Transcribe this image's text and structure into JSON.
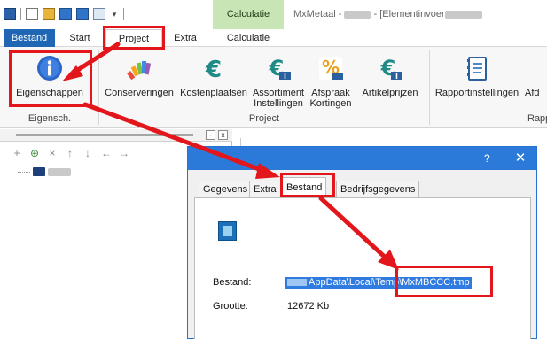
{
  "titlebar": {
    "context_tab": "Calculatie",
    "app_name": "MxMetaal - ",
    "separator": " - [Elementinvoer"
  },
  "tabs": {
    "file": "Bestand",
    "start": "Start",
    "project": "Project",
    "extra": "Extra",
    "calc": "Calculatie"
  },
  "ribbon": {
    "properties": "Eigenschappen",
    "conservations": "Conserveringen",
    "cost_centers": "Kostenplaatsen",
    "assortment_line1": "Assortiment",
    "assortment_line2": "Instellingen",
    "discount_line1": "Afspraak",
    "discount_line2": "Kortingen",
    "article_prices": "Artikelprijzen",
    "report_settings": "Rapportinstellingen",
    "afd": "Afd",
    "group_properties": "Eigensch.",
    "group_project": "Project",
    "group_report": "Rapp"
  },
  "panel": {
    "minimize": "-",
    "close": "x"
  },
  "dialog": {
    "help": "?",
    "close": "✕",
    "tabs": [
      "Gegevens",
      "Extra",
      "Bestand",
      "Bedrijfsgegevens"
    ],
    "file_label": "Bestand:",
    "file_path": "AppData\\Local\\Temp\\MxMBCCC.tmp",
    "size_label": "Grootte:",
    "size_value": "12672 Kb"
  },
  "colors": {
    "accent": "#1f66b4",
    "context_tab": "#c8e6b5",
    "annotation": "#e3161b",
    "selection": "#2f7be0"
  },
  "icons": {
    "properties": "info-icon",
    "conservations": "paint-palette-icon",
    "cost_centers": "euro-icon",
    "assortment": "euro-settings-icon",
    "discount": "percent-icon",
    "article_prices": "euro-article-icon",
    "report_settings": "notebook-icon"
  }
}
